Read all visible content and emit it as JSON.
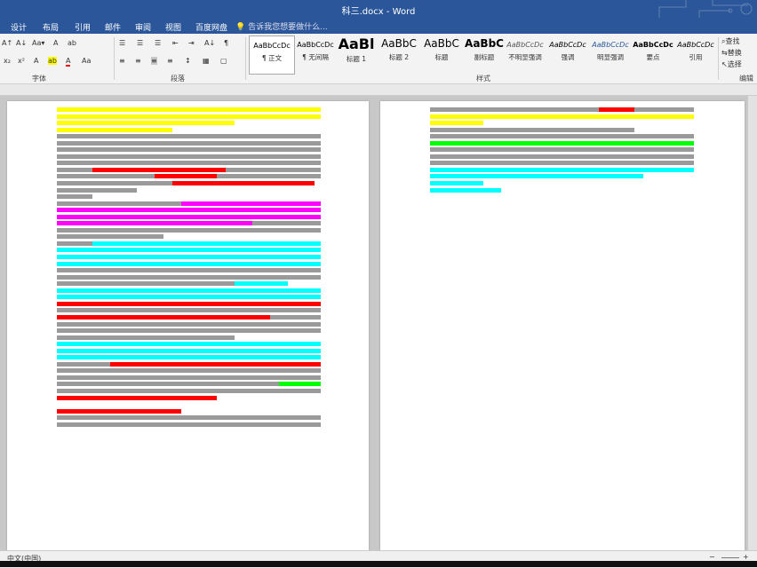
{
  "window": {
    "title": "科三.docx - Word"
  },
  "tabs": [
    "设计",
    "布局",
    "引用",
    "邮件",
    "审阅",
    "视图",
    "百度网盘"
  ],
  "search": {
    "placeholder": "告诉我您想要做什么..."
  },
  "ribbon": {
    "groups": {
      "font": "字体",
      "paragraph": "段落",
      "styles": "样式",
      "editing": "编辑"
    },
    "font_buttons": [
      "A↑",
      "A↓",
      "Aa▾",
      "A",
      "ab",
      "x₂",
      "x²",
      "A",
      "ab",
      "A",
      "Aa"
    ],
    "para_buttons": [
      "☰",
      "☰",
      "☰",
      "⇤",
      "⇥",
      "A↓",
      "¶",
      "≡",
      "≡",
      "≡",
      "≡",
      "↕",
      "▦",
      "▢"
    ],
    "styles": [
      {
        "preview": "AaBbCcDc",
        "name": "¶ 正文"
      },
      {
        "preview": "AaBbCcDc",
        "name": "¶ 无间隔"
      },
      {
        "preview": "AaBl",
        "name": "标题 1"
      },
      {
        "preview": "AaBbC",
        "name": "标题 2"
      },
      {
        "preview": "AaBbC",
        "name": "标题"
      },
      {
        "preview": "AaBbC",
        "name": "副标题"
      },
      {
        "preview": "AaBbCcDc",
        "name": "不明显强调"
      },
      {
        "preview": "AaBbCcDc",
        "name": "强调"
      },
      {
        "preview": "AaBbCcDc",
        "name": "明显强调"
      },
      {
        "preview": "AaBbCcDc",
        "name": "要点"
      },
      {
        "preview": "AaBbCcDc",
        "name": "引用"
      }
    ],
    "editing": [
      "查找",
      "替换",
      "选择"
    ]
  },
  "status": {
    "language": "中文(中国)"
  },
  "colors": {
    "accent": "#2b579a",
    "yellow": "#ffff00",
    "pink": "#ff00ff",
    "cyan": "#00ffff",
    "red": "#ff0000",
    "green": "#00ff00"
  }
}
